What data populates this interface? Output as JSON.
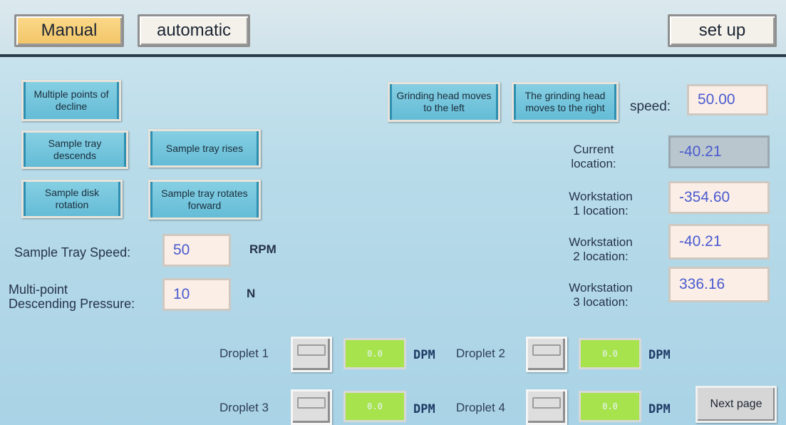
{
  "modes": {
    "manual": "Manual",
    "automatic": "automatic",
    "setup": "set up"
  },
  "buttons": {
    "multi_points": "Multiple points of decline",
    "tray_descends": "Sample tray descends",
    "tray_rises": "Sample tray rises",
    "disk_rotation": "Sample disk rotation",
    "tray_forward": "Sample tray rotates forward",
    "head_left": "Grinding head moves to the left",
    "head_right": "The grinding head moves to the right",
    "next_page": "Next page"
  },
  "speed": {
    "label": "speed:",
    "value": "50.00"
  },
  "tray_speed": {
    "label": "Sample Tray Speed:",
    "value": "50",
    "unit": "RPM"
  },
  "pressure": {
    "label_line1": "Multi-point",
    "label_line2": "Descending Pressure:",
    "value": "10",
    "unit": "N"
  },
  "locations": {
    "current_label_1": "Current",
    "current_label_2": "location:",
    "current_value": "-40.21",
    "ws1_label_1": "Workstation",
    "ws1_label_2": "1 location:",
    "ws1_value": "-354.60",
    "ws2_label_1": "Workstation",
    "ws2_label_2": "2 location:",
    "ws2_value": "-40.21",
    "ws3_label_1": "Workstation",
    "ws3_label_2": "3 location:",
    "ws3_value": "336.16"
  },
  "droplets": [
    {
      "label": "Droplet 1",
      "value": "0.0",
      "unit": "DPM"
    },
    {
      "label": "Droplet 2",
      "value": "0.0",
      "unit": "DPM"
    },
    {
      "label": "Droplet 3",
      "value": "0.0",
      "unit": "DPM"
    },
    {
      "label": "Droplet 4",
      "value": "0.0",
      "unit": "DPM"
    }
  ],
  "colors": {
    "manual_active": "#f2c467",
    "button_blue": "#64bcd6",
    "dpm_green": "#a7e34c",
    "value_text": "#4a5bd0"
  }
}
